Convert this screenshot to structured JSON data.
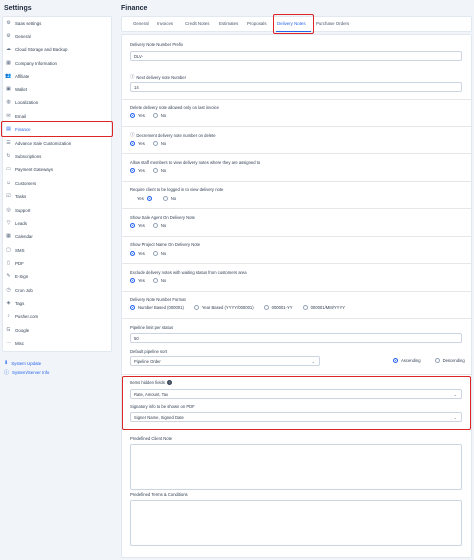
{
  "sidebar": {
    "title": "Settings",
    "items": [
      {
        "label": "Saas settings",
        "icon": "gear-icon"
      },
      {
        "label": "General",
        "icon": "cog-icon"
      },
      {
        "label": "Cloud Storage and Backup",
        "icon": "cloud-icon"
      },
      {
        "label": "Company Information",
        "icon": "building-icon"
      },
      {
        "label": "Affiliate",
        "icon": "users-icon"
      },
      {
        "label": "Wallet",
        "icon": "wallet-icon"
      },
      {
        "label": "Localization",
        "icon": "globe-icon"
      },
      {
        "label": "Email",
        "icon": "envelope-icon"
      },
      {
        "label": "Finance",
        "icon": "receipt-icon"
      },
      {
        "label": "Advance Sale Customization",
        "icon": "sliders-icon"
      },
      {
        "label": "Subscriptions",
        "icon": "refresh-icon"
      },
      {
        "label": "Payment Gateways",
        "icon": "credit-card-icon"
      },
      {
        "label": "Customers",
        "icon": "user-group-icon"
      },
      {
        "label": "Tasks",
        "icon": "tasks-icon"
      },
      {
        "label": "Support",
        "icon": "lifebuoy-icon"
      },
      {
        "label": "Leads",
        "icon": "funnel-icon"
      },
      {
        "label": "Calendar",
        "icon": "calendar-icon"
      },
      {
        "label": "SMS",
        "icon": "message-icon"
      },
      {
        "label": "PDF",
        "icon": "file-pdf-icon"
      },
      {
        "label": "E-Sign",
        "icon": "signature-icon"
      },
      {
        "label": "Cron Job",
        "icon": "clock-icon"
      },
      {
        "label": "Tags",
        "icon": "tag-icon"
      },
      {
        "label": "Pusher.com",
        "icon": "bell-icon"
      },
      {
        "label": "Google",
        "icon": "google-icon"
      },
      {
        "label": "Misc",
        "icon": "dots-icon"
      }
    ],
    "footer": [
      {
        "label": "System Update",
        "icon": "download-icon"
      },
      {
        "label": "System/Server Info",
        "icon": "info-icon"
      }
    ]
  },
  "main": {
    "title": "Finance",
    "tabs": [
      "General",
      "Invoices",
      "Credit Notes",
      "Estimates",
      "Proposals",
      "Delivery Notes",
      "Purchase Orders"
    ]
  },
  "form": {
    "prefix_label": "Delivery Note Number Prefix",
    "prefix_value": "DLV-",
    "next_number_label": "Next delivery note Number",
    "next_number_value": "14",
    "delete_last_label": "Delete delivery note allowed only on last invoice",
    "decrement_label": "Decrement delivery note number on delete",
    "staff_view_label": "Allow staff members to view delivery notes where they are assigned to",
    "require_login_label": "Require client to be logged in to view delivery note",
    "show_sale_agent_label": "Show Sale Agent On Delivery Note",
    "show_project_label": "Show Project Name On Delivery Note",
    "exclude_waiting_label": "Exclude delivery notes with waiting status from customers area",
    "yes": "Yes",
    "no": "No",
    "number_format_label": "Delivery Note Number Format",
    "format_options": [
      "Number Based (000001)",
      "Year Based (YYYY/000001)",
      "000001-YY",
      "000001/MM/YYYY"
    ],
    "pipeline_limit_label": "Pipeline limit per status",
    "pipeline_limit_value": "50",
    "pipeline_sort_label": "Default pipeline sort",
    "pipeline_sort_value": "Pipeline Order",
    "ascending": "Ascending",
    "descending": "Descending",
    "hidden_fields_label": "Items hidden fields",
    "hidden_fields_value": "Rate, Amount, Tax",
    "signatory_label": "Signatory info to be shown on PDF",
    "signatory_value": "Signer Name, Signed Date",
    "client_note_label": "Predefined Client Note",
    "terms_label": "Predefined Terms & Conditions"
  },
  "colors": {
    "accent": "#2563eb",
    "highlight": "#dc2626"
  }
}
